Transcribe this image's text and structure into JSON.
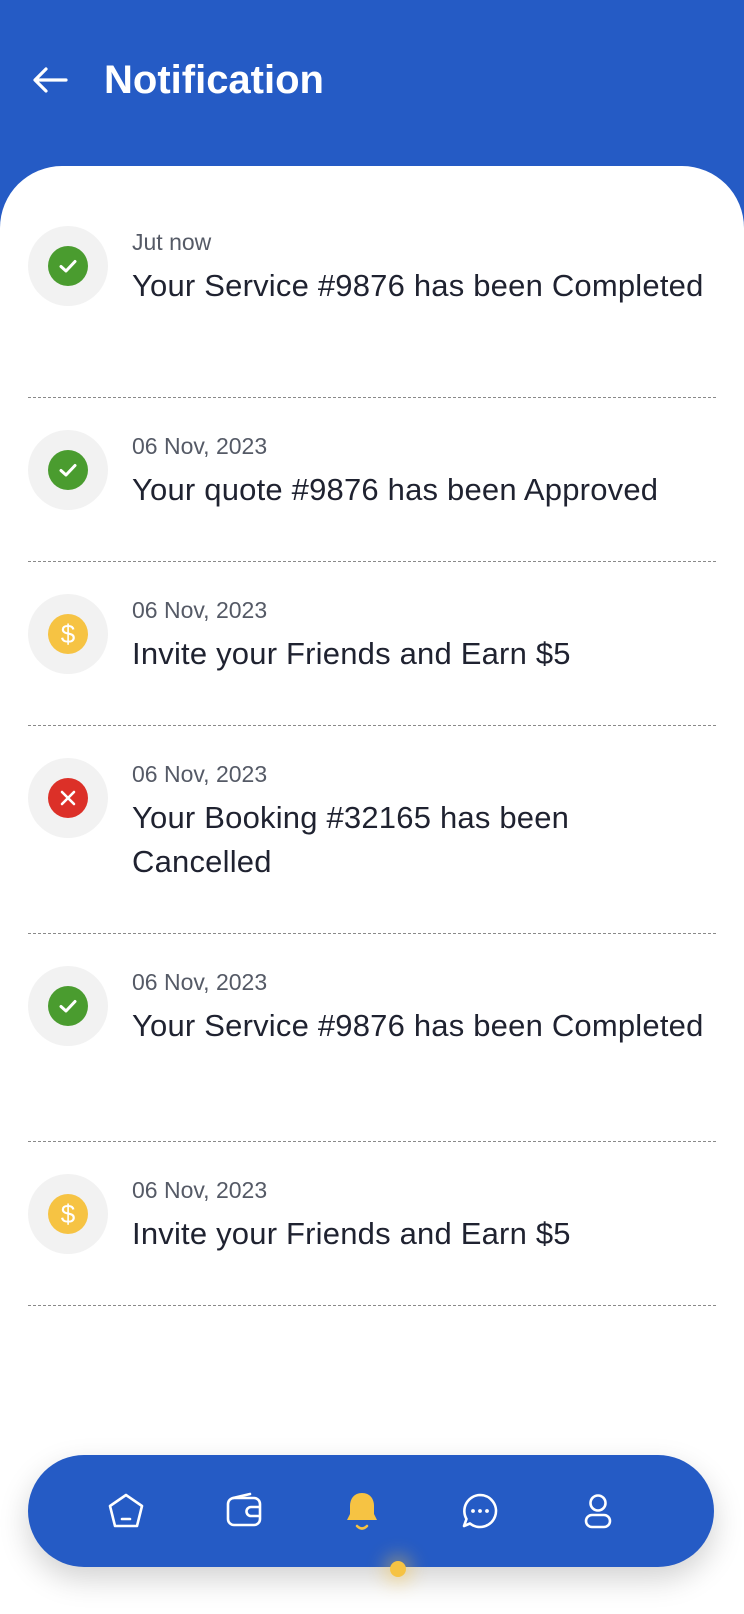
{
  "header": {
    "title": "Notification",
    "back_icon": "arrow-left-icon"
  },
  "colors": {
    "primary": "#255bc5",
    "success": "#4a9c2f",
    "error": "#dc3028",
    "reward": "#f6c343",
    "icon_bg": "#f2f2f2"
  },
  "notifications": [
    {
      "date": "Jut now",
      "message": "Your Service #9876 has been Completed",
      "icon": "check-circle-icon",
      "status": "success"
    },
    {
      "date": "06 Nov, 2023",
      "message": "Your quote #9876 has been Approved",
      "icon": "check-circle-icon",
      "status": "success"
    },
    {
      "date": "06 Nov, 2023",
      "message": "Invite your Friends and Earn $5",
      "icon": "dollar-coin-icon",
      "status": "reward"
    },
    {
      "date": "06 Nov, 2023",
      "message": "Your Booking #32165 has been Cancelled",
      "icon": "x-circle-icon",
      "status": "error"
    },
    {
      "date": "06 Nov, 2023",
      "message": "Your Service #9876 has been Completed",
      "icon": "check-circle-icon",
      "status": "success"
    },
    {
      "date": "06 Nov, 2023",
      "message": "Invite your Friends and Earn $5",
      "icon": "dollar-coin-icon",
      "status": "reward"
    }
  ],
  "bottom_nav": {
    "items": [
      {
        "icon": "home-icon",
        "active": false
      },
      {
        "icon": "wallet-icon",
        "active": false
      },
      {
        "icon": "bell-icon",
        "active": true
      },
      {
        "icon": "chat-icon",
        "active": false
      },
      {
        "icon": "profile-icon",
        "active": false
      }
    ]
  }
}
